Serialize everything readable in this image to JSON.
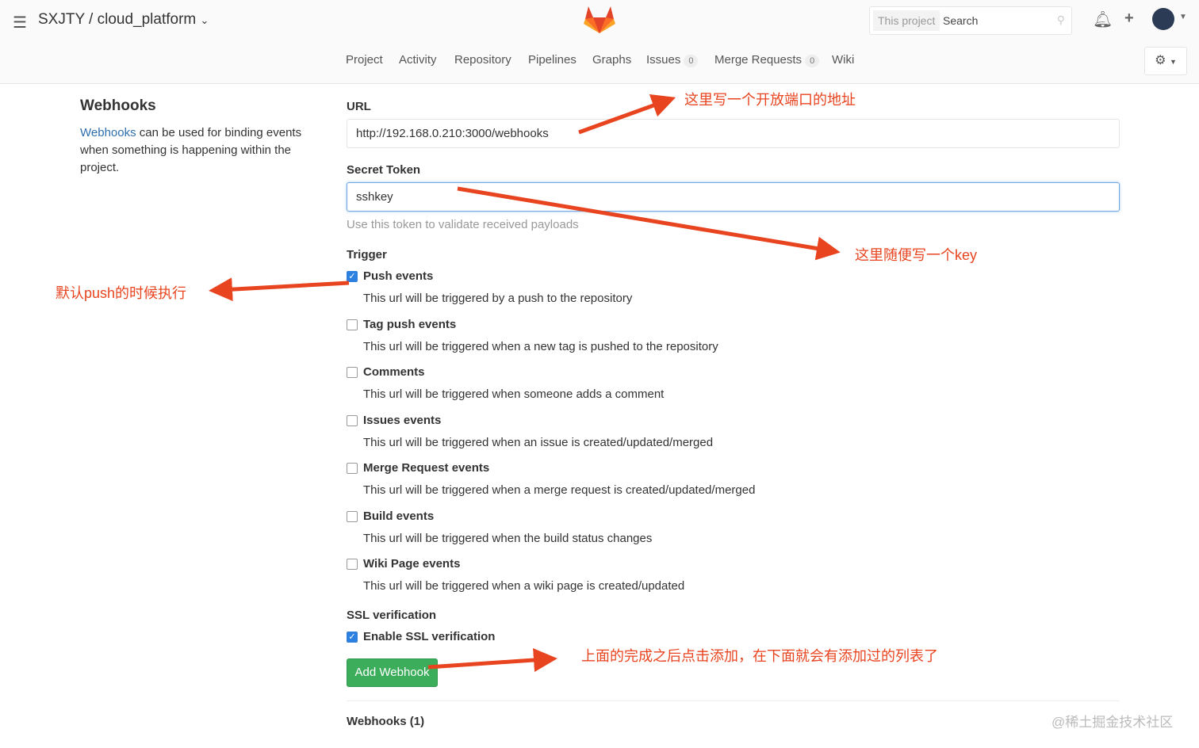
{
  "header": {
    "title": "SXJTY / cloud_platform",
    "search_scope": "This project",
    "search_placeholder": "Search"
  },
  "nav": [
    {
      "label": "Project"
    },
    {
      "label": "Activity"
    },
    {
      "label": "Repository"
    },
    {
      "label": "Pipelines"
    },
    {
      "label": "Graphs"
    },
    {
      "label": "Issues",
      "count": "0"
    },
    {
      "label": "Merge Requests",
      "count": "0"
    },
    {
      "label": "Wiki"
    }
  ],
  "side": {
    "title": "Webhooks",
    "link": "Webhooks",
    "text": " can be used for binding events when something is happening within the project."
  },
  "form": {
    "url_label": "URL",
    "url_value": "http://192.168.0.210:3000/webhooks",
    "token_label": "Secret Token",
    "token_value": "sshkey",
    "token_help": "Use this token to validate received payloads",
    "trigger_label": "Trigger",
    "triggers": [
      {
        "label": "Push events",
        "desc": "This url will be triggered by a push to the repository",
        "checked": true
      },
      {
        "label": "Tag push events",
        "desc": "This url will be triggered when a new tag is pushed to the repository",
        "checked": false
      },
      {
        "label": "Comments",
        "desc": "This url will be triggered when someone adds a comment",
        "checked": false
      },
      {
        "label": "Issues events",
        "desc": "This url will be triggered when an issue is created/updated/merged",
        "checked": false
      },
      {
        "label": "Merge Request events",
        "desc": "This url will be triggered when a merge request is created/updated/merged",
        "checked": false
      },
      {
        "label": "Build events",
        "desc": "This url will be triggered when the build status changes",
        "checked": false
      },
      {
        "label": "Wiki Page events",
        "desc": "This url will be triggered when a wiki page is created/updated",
        "checked": false
      }
    ],
    "ssl_label": "SSL verification",
    "ssl_checkbox": "Enable SSL verification",
    "submit": "Add Webhook",
    "list_title": "Webhooks (1)"
  },
  "annotations": {
    "url": "这里写一个开放端口的地址",
    "token": "这里随便写一个key",
    "push": "默认push的时候执行",
    "submit": "上面的完成之后点击添加，在下面就会有添加过的列表了",
    "color": "#e8441f"
  },
  "watermark": "@稀土掘金技术社区"
}
